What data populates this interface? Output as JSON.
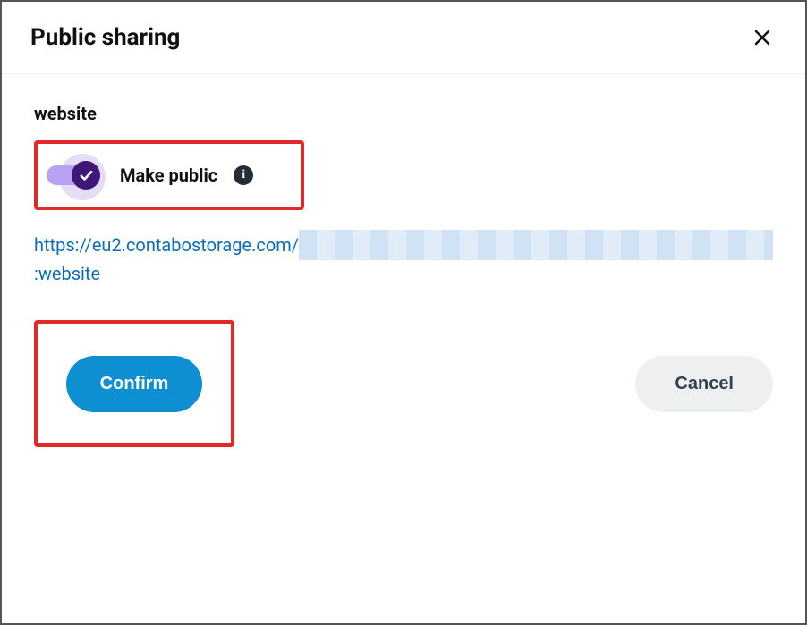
{
  "modal": {
    "title": "Public sharing"
  },
  "section": {
    "label": "website"
  },
  "toggle": {
    "label": "Make public",
    "state": true
  },
  "url": {
    "prefix": "https://eu2.contabostorage.com/",
    "suffix": ":website"
  },
  "buttons": {
    "confirm": "Confirm",
    "cancel": "Cancel"
  }
}
